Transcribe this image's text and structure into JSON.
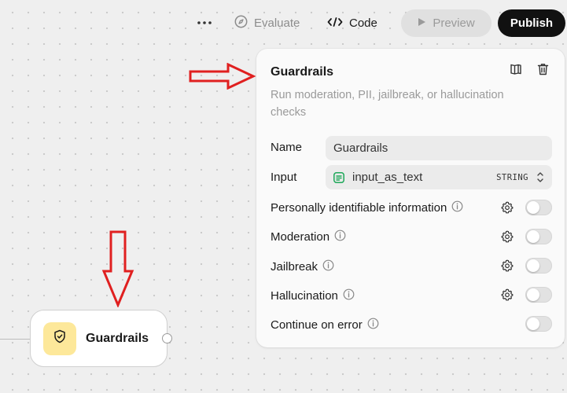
{
  "toolbar": {
    "evaluate_label": "Evaluate",
    "code_label": "Code",
    "preview_label": "Preview",
    "publish_label": "Publish"
  },
  "panel": {
    "title": "Guardrails",
    "description": "Run moderation, PII, jailbreak, or hallucination checks",
    "name_label": "Name",
    "name_value": "Guardrails",
    "input_label": "Input",
    "input_value": "input_as_text",
    "input_type": "STRING",
    "checks": [
      {
        "label": "Personally identifiable information",
        "has_info": true,
        "has_settings": true,
        "enabled": false
      },
      {
        "label": "Moderation",
        "has_info": true,
        "has_settings": true,
        "enabled": false
      },
      {
        "label": "Jailbreak",
        "has_info": true,
        "has_settings": true,
        "enabled": false
      },
      {
        "label": "Hallucination",
        "has_info": true,
        "has_settings": true,
        "enabled": false
      },
      {
        "label": "Continue on error",
        "has_info": true,
        "has_settings": false,
        "enabled": false
      }
    ]
  },
  "node": {
    "label": "Guardrails",
    "icon": "shield-check-icon",
    "icon_bg": "#fde89a"
  },
  "annotations": {
    "arrow_color": "#e02020"
  }
}
